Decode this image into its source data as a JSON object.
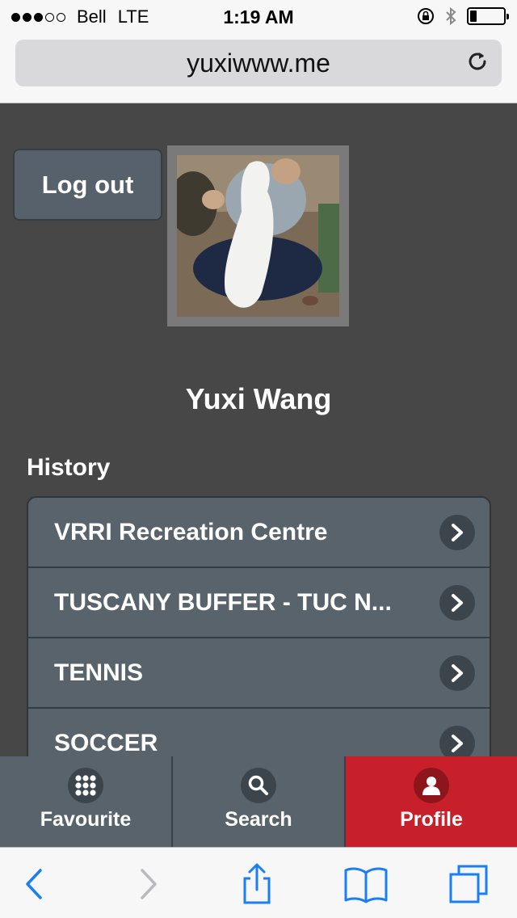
{
  "status_bar": {
    "carrier": "Bell",
    "network": "LTE",
    "time": "1:19 AM",
    "signal_bars_filled": 3,
    "signal_bars_total": 5,
    "battery_level": 0.2
  },
  "browser": {
    "url": "yuxiwww.me",
    "icons": {
      "reload": "reload-icon",
      "back": "back-icon",
      "forward": "forward-icon",
      "share": "share-icon",
      "bookmarks": "bookmarks-icon",
      "tabs": "tabs-icon"
    }
  },
  "profile": {
    "logout_label": "Log out",
    "user_name": "Yuxi Wang",
    "avatar_icon": "profile-photo"
  },
  "history": {
    "heading": "History",
    "items": [
      {
        "label": "VRRI Recreation Centre"
      },
      {
        "label": "TUSCANY BUFFER - TUC N..."
      },
      {
        "label": "TENNIS"
      },
      {
        "label": "SOCCER"
      }
    ]
  },
  "tabbar": {
    "tabs": [
      {
        "label": "Favourite",
        "icon": "grid-icon",
        "active": false
      },
      {
        "label": "Search",
        "icon": "search-icon",
        "active": false
      },
      {
        "label": "Profile",
        "icon": "user-icon",
        "active": true
      }
    ]
  },
  "colors": {
    "accent_active": "#c8202a",
    "panel": "#58636c",
    "background": "#474747",
    "ios_blue": "#1a7ef5"
  }
}
